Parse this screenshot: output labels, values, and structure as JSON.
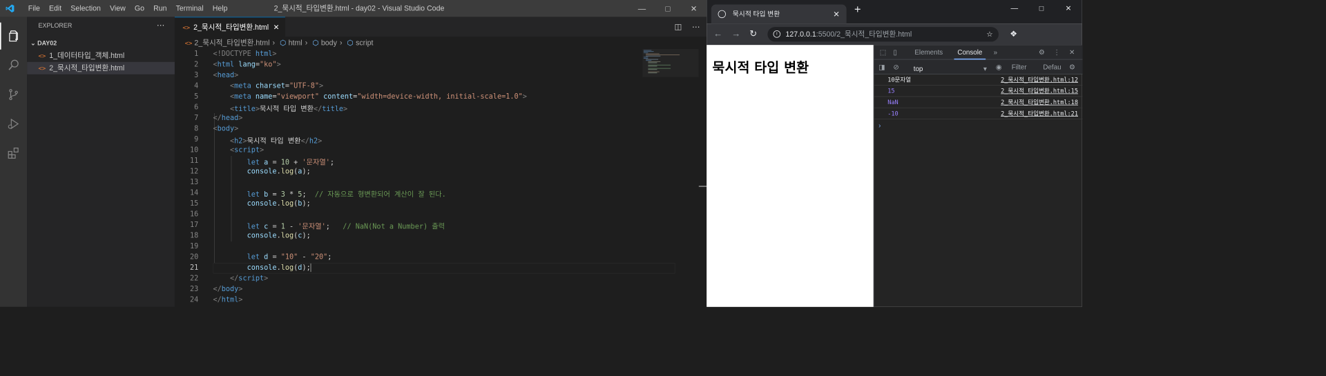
{
  "vscode": {
    "menu": [
      "File",
      "Edit",
      "Selection",
      "View",
      "Go",
      "Run",
      "Terminal",
      "Help"
    ],
    "window_title": "2_묵시적_타입변환.html - day02 - Visual Studio Code",
    "explorer": {
      "title": "EXPLORER",
      "folder": "DAY02",
      "files": [
        "1_데이터타입_객체.html",
        "2_묵시적_타입변환.html"
      ]
    },
    "tab": {
      "label": "2_묵시적_타입변환.html"
    },
    "breadcrumb": [
      "2_묵시적_타입변환.html",
      "html",
      "body",
      "script"
    ],
    "line_numbers": [
      "1",
      "2",
      "3",
      "4",
      "5",
      "6",
      "7",
      "8",
      "9",
      "10",
      "11",
      "12",
      "13",
      "14",
      "15",
      "16",
      "17",
      "18",
      "19",
      "20",
      "21",
      "22",
      "23",
      "24"
    ],
    "code": {
      "l1_a": "<!DOCTYPE",
      "l1_b": "html",
      "l1_c": ">",
      "l2_lang": "\"ko\"",
      "l4_charset": "\"UTF-8\"",
      "l5_name": "\"viewport\"",
      "l5_content": "\"width=device-width, initial-scale=1.0\"",
      "l6_text": "묵시적 타입 변환",
      "l9_text": "묵시적 타입 변환",
      "l11_str": "'문자열'",
      "l14_comment": "// 자동으로 형변환되어 계산이 잘 된다.",
      "l17_str": "'문자열'",
      "l17_comment": "// NaN(Not a Number) 출력",
      "l20_s1": "\"10\"",
      "l20_s2": "\"20\""
    }
  },
  "browser": {
    "tab_title": "묵시적 타입 변환",
    "url_host": "127.0.0.1",
    "url_path": ":5500/2_묵시적_타입변환.html",
    "page_heading": "묵시적 타입 변환",
    "devtools": {
      "tabs": [
        "Elements",
        "Console"
      ],
      "context": "top",
      "filter_placeholder": "Filter",
      "levels": "Defau",
      "logs": [
        {
          "value": "10문자열",
          "source": "2_묵시적_타입변환.html:12",
          "numeric": false
        },
        {
          "value": "15",
          "source": "2_묵시적_타입변환.html:15",
          "numeric": true
        },
        {
          "value": "NaN",
          "source": "2_묵시적_타입변환.html:18",
          "numeric": true
        },
        {
          "value": "-10",
          "source": "2_묵시적_타입변환.html:21",
          "numeric": true
        }
      ]
    }
  }
}
